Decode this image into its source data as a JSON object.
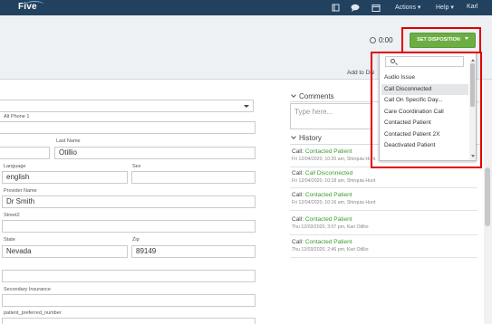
{
  "topbar": {
    "logo": "Five",
    "menus": {
      "actions": "Actions",
      "help": "Help",
      "user": "Karl"
    },
    "icons": [
      "book-icon",
      "chat-icon",
      "calendar-icon"
    ]
  },
  "header": {
    "timer": "0:00",
    "disposition_button": "SET DISPOSITION",
    "add_to": "Add to DN"
  },
  "form": {
    "alt_phone_label": "Alt Phone 1",
    "last_name_label": "Last Name",
    "last_name_value": "Otillio",
    "language_label": "Language",
    "language_value": "english",
    "sex_label": "Sex",
    "provider_label": "Provider Name",
    "provider_value": "Dr Smith",
    "street2_label": "Street2",
    "state_label": "State",
    "state_value": "Nevada",
    "zip_label": "Zip",
    "zip_value": "89149",
    "secondary_insurance_label": "Secondary Insurance",
    "preferred_number_label": "patient_preferred_number"
  },
  "comments": {
    "title": "Comments",
    "placeholder": "Type here..."
  },
  "history": {
    "title": "History",
    "items": [
      {
        "prefix": "Call:",
        "status": "Contacted Patient",
        "meta": "Fri 12/04/2020, 10:20 am, Shirquia Hunt"
      },
      {
        "prefix": "Call:",
        "status": "Call Disconnected",
        "meta": "Fri 12/04/2020, 10:18 am, Shirquia Hunt"
      },
      {
        "prefix": "Call:",
        "status": "Contacted Patient",
        "meta": "Fri 12/04/2020, 10:16 am, Shirquia Hunt"
      },
      {
        "prefix": "Call:",
        "status": "Contacted Patient",
        "meta": "Thu 12/03/2020, 3:07 pm, Kari Otillio"
      },
      {
        "prefix": "Call:",
        "status": "Contacted Patient",
        "meta": "Thu 12/03/2020, 2:46 pm, Kari Otillio"
      }
    ]
  },
  "dropdown": {
    "items": [
      "Audio Issue",
      "Call Disconnected",
      "Call On Specific Day...",
      "Care Coordination Call",
      "Contacted Patient",
      "Contacted Patient 2X",
      "Deactivated Patient"
    ],
    "selected": "Call Disconnected"
  },
  "colors": {
    "topbar": "#22415f",
    "accent_green": "#6cae43",
    "status_green": "#3d9a2f",
    "highlight_red": "#e10000"
  }
}
